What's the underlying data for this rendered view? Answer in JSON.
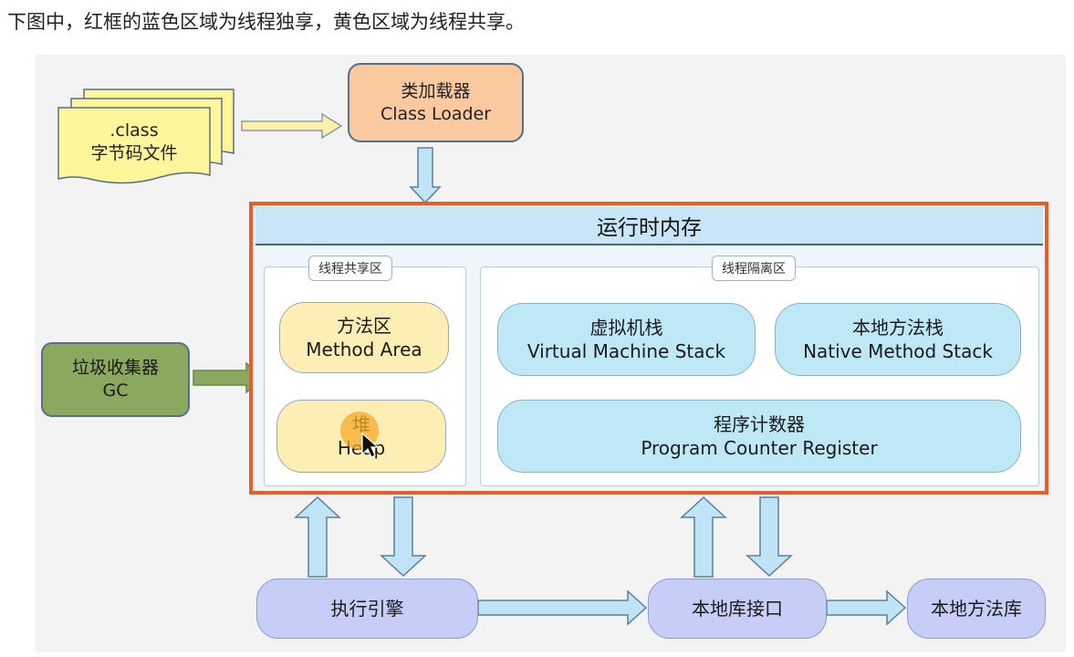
{
  "caption": "下图中，红框的蓝色区域为线程独享，黄色区域为线程共享。",
  "class_file": {
    "line1": ".class",
    "line2": "字节码文件"
  },
  "class_loader": {
    "zh": "类加载器",
    "en": "Class Loader"
  },
  "gc": {
    "zh": "垃圾收集器",
    "en": "GC"
  },
  "runtime_memory": {
    "title": "运行时内存"
  },
  "shared_zone": {
    "label": "线程共享区",
    "method_area": {
      "zh": "方法区",
      "en": "Method Area"
    },
    "heap": {
      "zh": "堆",
      "en": "Heap"
    }
  },
  "isolated_zone": {
    "label": "线程隔离区",
    "vm_stack": {
      "zh": "虚拟机栈",
      "en": "Virtual Machine Stack"
    },
    "native_stack": {
      "zh": "本地方法栈",
      "en": "Native Method Stack"
    },
    "pc_register": {
      "zh": "程序计数器",
      "en": "Program Counter Register"
    }
  },
  "execution_engine": "执行引擎",
  "native_interface": "本地库接口",
  "native_library": "本地方法库",
  "colors": {
    "runtime_border": "#f05a23",
    "shared_fill": "#fdeeb6",
    "isolated_fill": "#bfe8f7",
    "arrow_fill": "#bfe4f6",
    "gc_fill": "#8ba85f",
    "loader_fill": "#fbc9a0",
    "doc_fill": "#fff59a"
  }
}
